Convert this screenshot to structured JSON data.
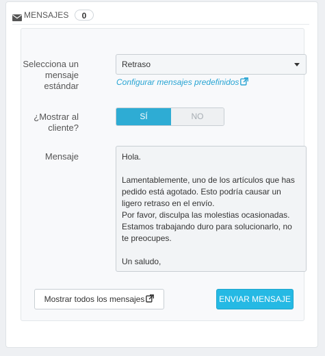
{
  "header": {
    "icon": "envelope-icon",
    "title": "MENSAJES",
    "count": "0"
  },
  "form": {
    "select_label_line1": "Selecciona un",
    "select_label_line2": "mensaje",
    "select_label_line3": "estándar",
    "selected_message": "Retraso",
    "config_link": "Configurar mensajes predefinidos",
    "show_label_line1": "¿Mostrar al",
    "show_label_line2": "cliente?",
    "toggle_yes": "SÍ",
    "toggle_no": "NO",
    "toggle_value": "yes",
    "message_label": "Mensaje",
    "message_text": "Hola.\n\nLamentablemente, uno de los artículos que has pedido está agotado. Esto podría causar un ligero retraso en el envío.\nPor favor, disculpa las molestias ocasionadas.\nEstamos trabajando duro para solucionarlo, no te preocupes.\n\nUn saludo,",
    "show_all_button": "Mostrar todos los mensajes",
    "send_button": "ENVIAR MENSAJE"
  },
  "colors": {
    "accent": "#25b9e4",
    "toggle_active": "#2eacd4",
    "link": "#27a4d3"
  }
}
